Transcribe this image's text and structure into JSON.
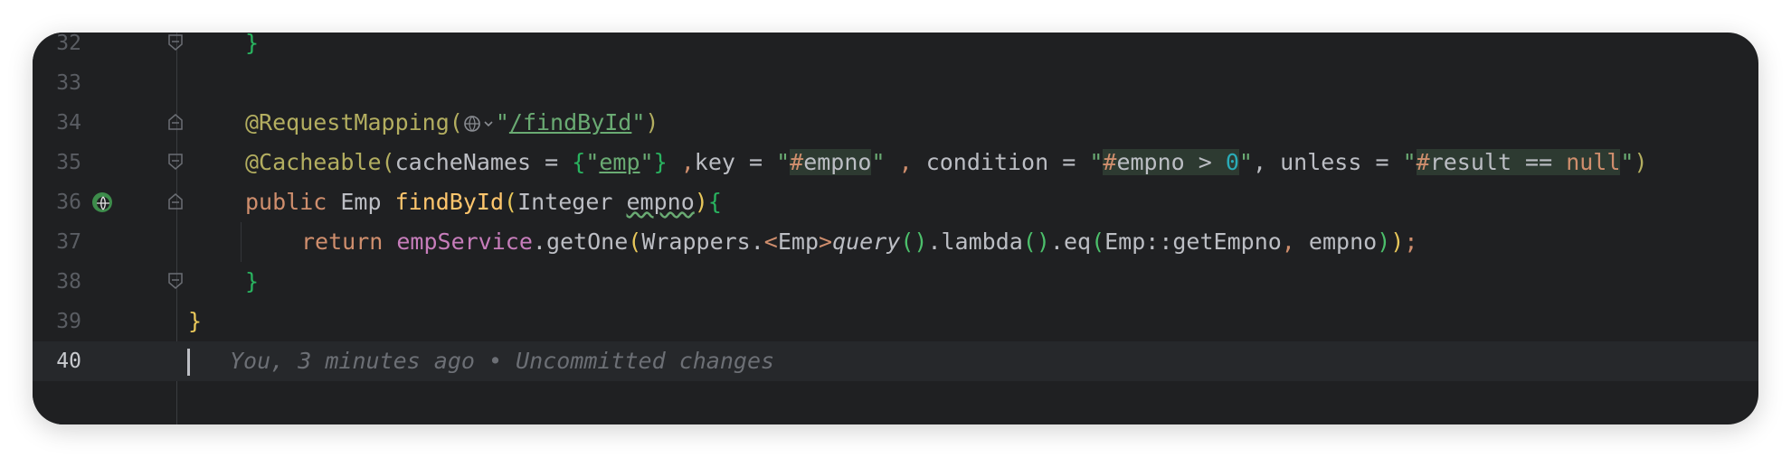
{
  "editor": {
    "lines": [
      {
        "num": "32"
      },
      {
        "num": "33"
      },
      {
        "num": "34"
      },
      {
        "num": "35"
      },
      {
        "num": "36"
      },
      {
        "num": "37"
      },
      {
        "num": "38"
      },
      {
        "num": "39"
      },
      {
        "num": "40"
      }
    ],
    "blame_text": "You, 3 minutes ago • Uncommitted changes"
  },
  "code": {
    "l32_brace": "}",
    "l34_annot": "@RequestMapping(",
    "l34_path": "/findById",
    "l34_close": ")",
    "l35_annot": "@Cacheable(",
    "l35_t1": "cacheNames = ",
    "l35_cache": "emp",
    "l35_t2": " ,",
    "l35_t3": "key = ",
    "l35_key": "#empno",
    "l35_t4": " , condition = ",
    "l35_cond_hash": "#",
    "l35_cond_name": "empno > ",
    "l35_cond_num": "0",
    "l35_t5": ", unless = ",
    "l35_unl_hash": "#",
    "l35_unl_name": "result == ",
    "l35_unl_null": "null",
    "l36_public": "public",
    "l36_type": "Emp",
    "l36_method": "findById",
    "l36_ptype": "Integer",
    "l36_param": "empno",
    "l37_return": "return",
    "l37_service": "empService",
    "l37_getone": ".getOne",
    "l37_wrappers": "Wrappers.",
    "l37_generic": "<Emp>",
    "l37_query": "query",
    "l37_lambda": ".lambda",
    "l37_eq": ".eq",
    "l37_ref": "Emp::getEmpno",
    "l37_arg": "empno",
    "l38_brace": "}",
    "l39_brace": "}"
  },
  "colors": {
    "background": "#1f2022",
    "keyword": "#cf8e6d",
    "annotation": "#b3ae60",
    "string": "#6aab73",
    "method": "#ffc66d",
    "field": "#c77dbb"
  }
}
